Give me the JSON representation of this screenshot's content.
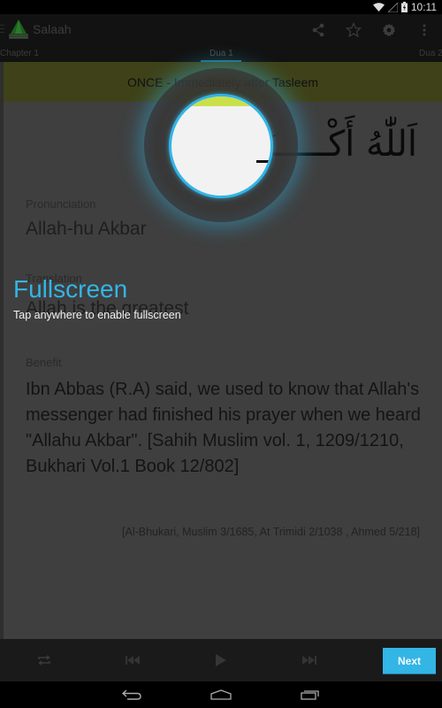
{
  "status_bar": {
    "time": "10:11",
    "icons": [
      "wifi-icon",
      "signal-icon",
      "battery-charging-icon"
    ]
  },
  "action_bar": {
    "app_title": "Salaah",
    "actions": [
      {
        "name": "share",
        "icon": "share-icon"
      },
      {
        "name": "favorite",
        "icon": "star-icon"
      },
      {
        "name": "settings",
        "icon": "gear-icon"
      },
      {
        "name": "overflow",
        "icon": "overflow-menu-icon"
      }
    ]
  },
  "tabs": {
    "items": [
      "Chapter 1",
      "Dua 1",
      "Dua 2"
    ],
    "selected": "Dua 1"
  },
  "dua": {
    "timing_banner": "ONCE - Immediately after Tasleem",
    "arabic": "اَللّٰهُ أَكْـــــبَرُ",
    "pronunciation_label": "Pronunciation",
    "pronunciation": "Allah-hu Akbar",
    "translation_label": "Translation",
    "translation": "Allah is the greatest",
    "benefit_label": "Benefit",
    "benefit": "Ibn Abbas (R.A) said, we used to know that Allah's messenger had finished his prayer when we heard \"Allahu Akbar\". [Sahih Muslim vol. 1, 1209/1210, Bukhari Vol.1 Book 12/802]",
    "reference": "[Al-Bhukari, Muslim 3/1685, At Trimidi 2/1038 , Ahmed 5/218]"
  },
  "controls": {
    "buttons": [
      "repeat-icon",
      "skip-previous-icon",
      "play-icon",
      "skip-next-icon"
    ],
    "next_label": "Next"
  },
  "showcase": {
    "title": "Fullscreen",
    "text": "Tap anywhere to enable fullscreen"
  },
  "colors": {
    "accent": "#33b5e5",
    "banner": "#c9e04a"
  }
}
